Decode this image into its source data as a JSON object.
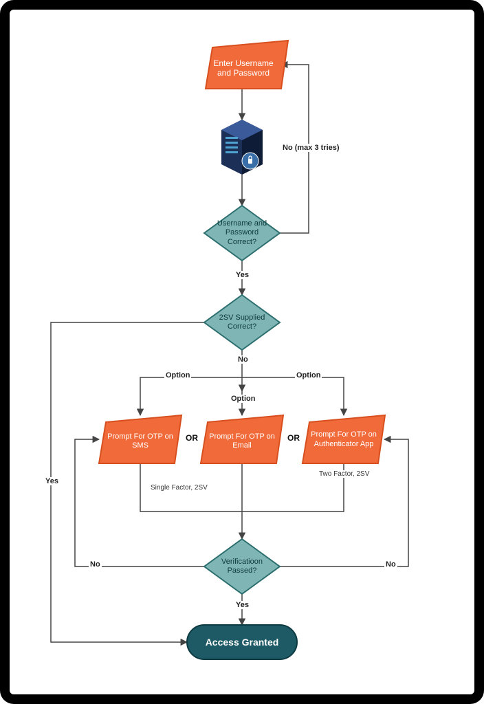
{
  "nodes": {
    "enter": "Enter Username and Password",
    "check": "Username and Password Correct?",
    "twosv": "2SV Supplied Correct?",
    "otp_sms": "Prompt For OTP on SMS",
    "otp_email": "Prompt For OTP on Email",
    "otp_app": "Prompt For OTP on Authenticator App",
    "verify": "Verificatioon Passed?",
    "granted": "Access Granted"
  },
  "labels": {
    "no_retry": "No (max 3 tries)",
    "yes1": "Yes",
    "no_2sv": "No",
    "option_l": "Option",
    "option_c": "Option",
    "option_r": "Option",
    "or1": "OR",
    "or2": "OR",
    "single_factor": "Single Factor, 2SV",
    "two_factor": "Two Factor, 2SV",
    "yes_verify": "Yes",
    "no_left": "No",
    "no_right": "No",
    "yes_2sv": "Yes"
  },
  "colors": {
    "orange_fill": "#f16b3a",
    "orange_stroke": "#d84f1f",
    "teal_fill": "#7fb5b5",
    "teal_stroke": "#2d6f6f",
    "dark_teal": "#1d5a66",
    "line": "#444"
  }
}
